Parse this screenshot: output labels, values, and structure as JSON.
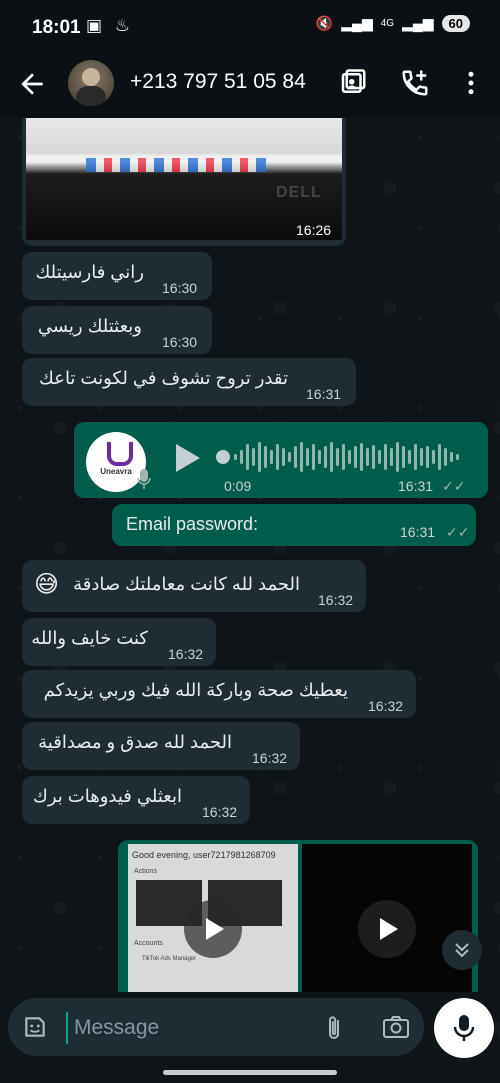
{
  "status": {
    "time": "18:01",
    "network": "4G",
    "battery": "60"
  },
  "header": {
    "contact": "+213 797 51 05 84"
  },
  "messages": {
    "image1_time": "16:26",
    "m1": {
      "text": "راني فارسيتلك",
      "time": "16:30"
    },
    "m2": {
      "text": "وبعثتلك ريسي",
      "time": "16:30"
    },
    "m3": {
      "text": "تقدر تروح  تشوف في لكونت تاعك",
      "time": "16:31"
    },
    "voice": {
      "duration": "0:09",
      "time": "16:31",
      "logo_text": "Uneavra"
    },
    "m4": {
      "text": "Email password:",
      "time": "16:31"
    },
    "m5": {
      "text": "الحمد لله كانت معاملتك صادقة",
      "emoji": "😅",
      "time": "16:32"
    },
    "m6": {
      "text": "كنت خايف والله",
      "time": "16:32"
    },
    "m7": {
      "text": "يعطيك صحة وباركة الله فيك وربي يزيدكم",
      "time": "16:32"
    },
    "m8": {
      "text": "الحمد لله صدق و مصداقية",
      "time": "16:32"
    },
    "m9": {
      "text": "ابعثلي فيدوهات برك",
      "time": "16:32"
    },
    "video1": {
      "greeting": "Good evening, user7217981268709",
      "section1": "Actions",
      "section2": "Accounts",
      "account": "TikTok Ads Manager"
    }
  },
  "input": {
    "placeholder": "Message"
  }
}
